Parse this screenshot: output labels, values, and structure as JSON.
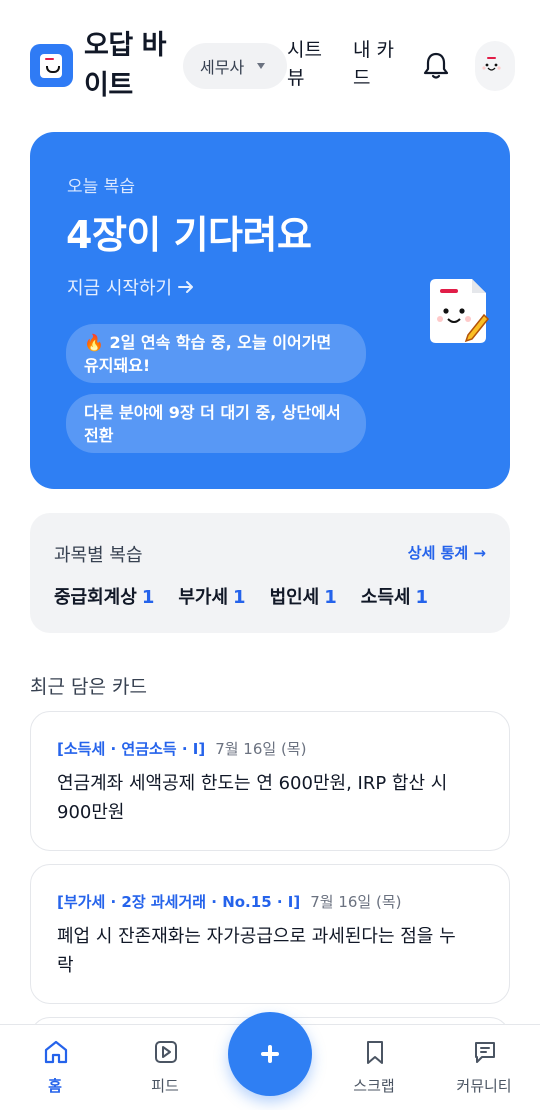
{
  "header": {
    "app_name": "오답 바이트",
    "category": "세무사",
    "nav": {
      "sheet": "시트뷰",
      "mycard": "내 카드"
    }
  },
  "hero": {
    "kicker": "오늘 복습",
    "title": "4장이 기다려요",
    "cta": "지금 시작하기",
    "streak": "🔥 2일 연속 학습 중, 오늘 이어가면 유지돼요!",
    "waiting": "다른 분야에 9장 더 대기 중, 상단에서 전환"
  },
  "subjects": {
    "title": "과목별 복습",
    "stats_link": "상세 통계 →",
    "items": [
      {
        "name": "중급회계상",
        "count": "1"
      },
      {
        "name": "부가세",
        "count": "1"
      },
      {
        "name": "법인세",
        "count": "1"
      },
      {
        "name": "소득세",
        "count": "1"
      }
    ]
  },
  "recent": {
    "title": "최근 담은 카드",
    "cards": [
      {
        "tag": "[소득세 · 연금소득 · I]",
        "date": "7월 16일 (목)",
        "body": "연금계좌 세액공제 한도는 연 600만원, IRP 합산 시 900만원"
      },
      {
        "tag": "[부가세 · 2장 과세거래 · No.15 · I]",
        "date": "7월 16일 (목)",
        "body": "폐업 시 잔존재화는 자가공급으로 과세된다는 점을 누락"
      }
    ]
  },
  "bottom_nav": {
    "home": "홈",
    "feed": "피드",
    "scrap": "스크랩",
    "community": "커뮤니티"
  },
  "colors": {
    "primary": "#2f7ff3",
    "link": "#2563eb"
  }
}
